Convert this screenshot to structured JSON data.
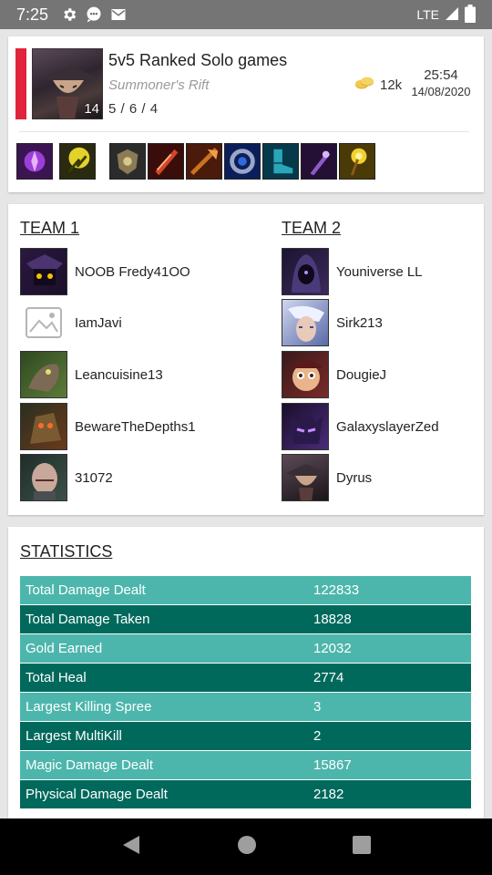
{
  "status_bar": {
    "time": "7:25",
    "network": "LTE"
  },
  "match": {
    "title": "5v5 Ranked Solo games",
    "map": "Summoner's Rift",
    "kda": "5 / 6 / 4",
    "champion_level": "14",
    "gold": "12k",
    "time": "25:54",
    "date": "14/08/2020",
    "accent_color": "#e0243b",
    "summoner_spells": [
      "purple-summoner-spell-icon",
      "yellow-flash-spell-icon"
    ],
    "items": [
      "shield-item-icon",
      "red-blade-item-icon",
      "orange-axe-item-icon",
      "blue-ring-item-icon",
      "teal-boots-item-icon",
      "purple-blade-item-icon",
      "golden-staff-item-icon"
    ]
  },
  "teams": {
    "team1": {
      "title": "TEAM 1",
      "players": [
        {
          "name": "NOOB Fredy41OO"
        },
        {
          "name": "IamJavi"
        },
        {
          "name": "Leancuisine13"
        },
        {
          "name": "BewareTheDepths1"
        },
        {
          "name": "31072"
        }
      ]
    },
    "team2": {
      "title": "TEAM 2",
      "players": [
        {
          "name": "Youniverse LL"
        },
        {
          "name": "Sirk213"
        },
        {
          "name": "DougieJ"
        },
        {
          "name": "GalaxyslayerZed"
        },
        {
          "name": "Dyrus"
        }
      ]
    }
  },
  "statistics": {
    "title": "STATISTICS",
    "colors": {
      "light": "#4db6ac",
      "dark": "#00695c"
    },
    "rows": [
      {
        "label": "Total Damage Dealt",
        "value": "122833"
      },
      {
        "label": "Total Damage Taken",
        "value": "18828"
      },
      {
        "label": "Gold Earned",
        "value": "12032"
      },
      {
        "label": "Total Heal",
        "value": "2774"
      },
      {
        "label": "Largest Killing Spree",
        "value": "3"
      },
      {
        "label": "Largest MultiKill",
        "value": "2"
      },
      {
        "label": "Magic Damage Dealt",
        "value": "15867"
      },
      {
        "label": "Physical Damage Dealt",
        "value": "2182"
      }
    ]
  },
  "nav": [
    "back-icon",
    "home-icon",
    "recents-icon"
  ]
}
